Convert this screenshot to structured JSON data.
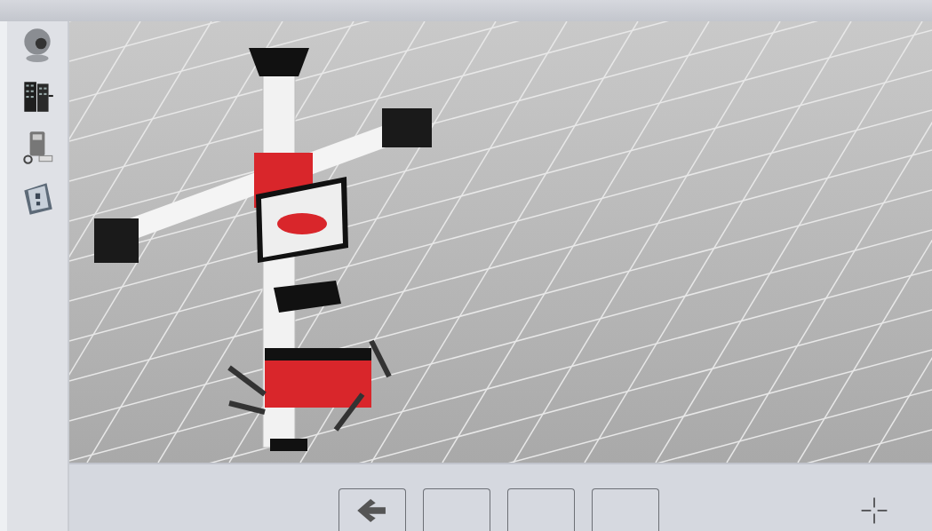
{
  "sidebar": {
    "items": [
      {
        "kind": "camera"
      },
      {
        "kind": "building"
      },
      {
        "kind": "device"
      },
      {
        "kind": "help"
      }
    ]
  },
  "bottom_bar": {
    "buttons": [
      {
        "kind": "back"
      },
      {
        "kind": "blank"
      },
      {
        "kind": "blank"
      },
      {
        "kind": "blank"
      }
    ]
  }
}
